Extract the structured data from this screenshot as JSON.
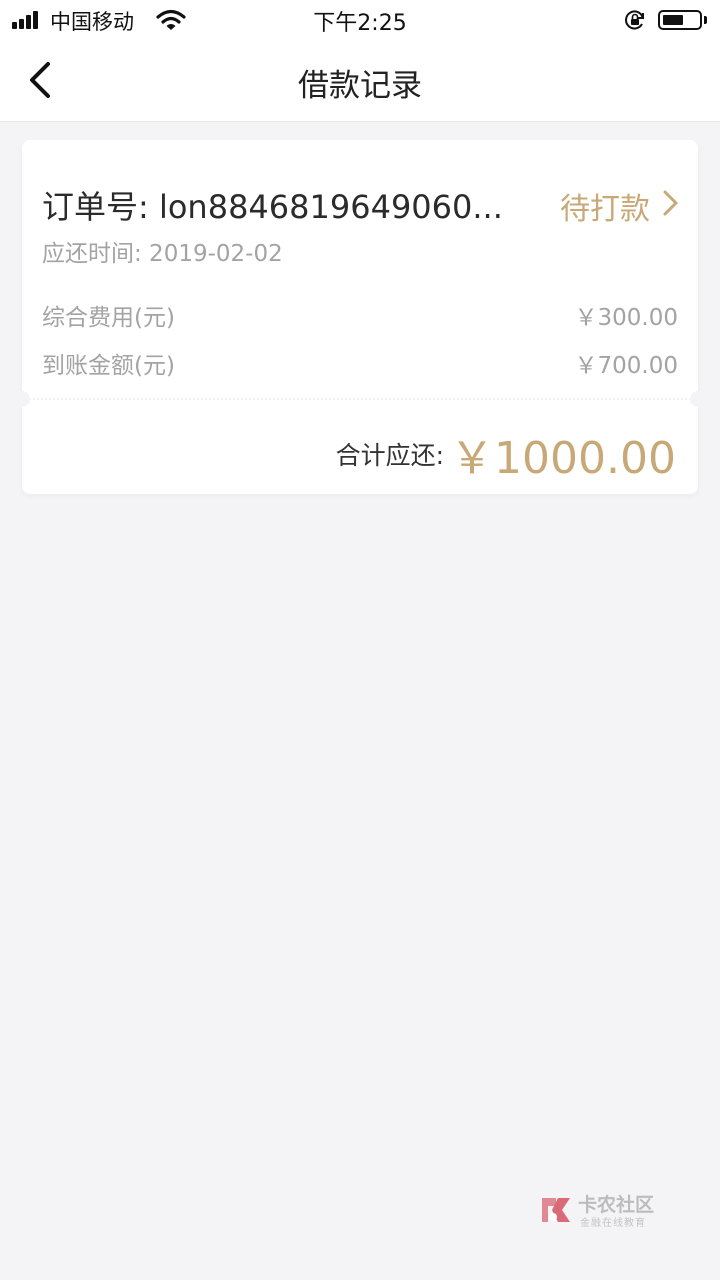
{
  "status_bar": {
    "carrier": "中国移动",
    "time": "下午2:25"
  },
  "header": {
    "title": "借款记录"
  },
  "record": {
    "order_number": "订单号: lon8846819649060...",
    "status": "待打款",
    "due_date": "应还时间: 2019-02-02",
    "fees": [
      {
        "label": "综合费用(元)",
        "value": "￥300.00"
      },
      {
        "label": "到账金额(元)",
        "value": "￥700.00"
      }
    ],
    "total_label": "合计应还:",
    "total_value": "￥1000.00"
  },
  "watermark": {
    "title": "卡农社区",
    "subtitle": "金融在线教育"
  },
  "colors": {
    "accent_gold": "#c8a876",
    "background": "#f4f4f6",
    "muted_text": "#a3a3a3"
  },
  "icons": [
    "signal-icon",
    "wifi-icon",
    "orientation-lock-icon",
    "battery-icon",
    "back-arrow-icon",
    "chevron-right-icon",
    "watermark-logo-icon"
  ]
}
